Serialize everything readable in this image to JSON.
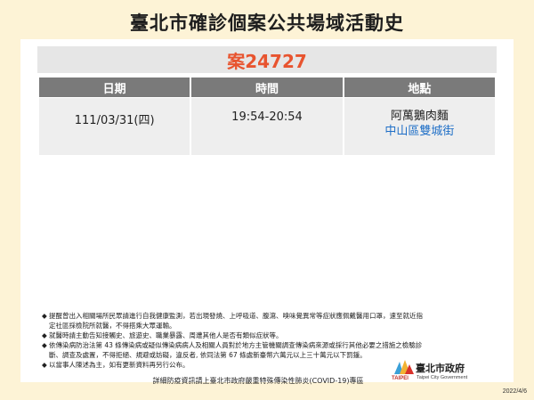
{
  "header": {
    "title": "臺北市確診個案公共場域活動史"
  },
  "case": {
    "label": "案24727"
  },
  "table": {
    "headers": [
      "日期",
      "時間",
      "地點"
    ],
    "rows": [
      {
        "date": "111/03/31(四)",
        "time": "19:54-20:54",
        "place_name": "阿萬鵝肉麵",
        "place_address": "中山區雙城街"
      }
    ]
  },
  "notes": [
    "提醒曾出入相關場所民眾請進行自我健康監測，若出現發燒、上呼吸道、腹瀉、嗅味覺異常等症狀應佩戴醫用口罩，速至就近指定社區採檢院所就醫，不得搭乘大眾運輸。",
    "就醫時請主動告知接觸史、旅遊史、職業暴露、周遭其他人是否有類似症狀等。",
    "依傳染病防治法第 43 條傳染病或疑似傳染病病人及相關人員對於地方主管機關調查傳染病來源或採行其他必要之措施之檢驗診斷、調查及處置，不得拒絕、規避或妨礙，違反者, 依同法第 67 條處新臺幣六萬元以上三十萬元以下罰鍰。",
    "以當事人陳述為主，如有更新資料再另行公布。"
  ],
  "bullet_symbol": "◆",
  "footer": {
    "text": "詳細防疫資訊請上臺北市政府嚴重特殊傳染性肺炎(COVID-19)專區"
  },
  "logo": {
    "word": "TAIPEI",
    "cn": "臺北市政府",
    "en": "Taipei City Government"
  },
  "date": "2022/4/6",
  "colors": {
    "background": "#fdf3d6",
    "case_label": "#e8542f",
    "header_bg": "#7a7a7a",
    "address": "#1f6fc7"
  }
}
